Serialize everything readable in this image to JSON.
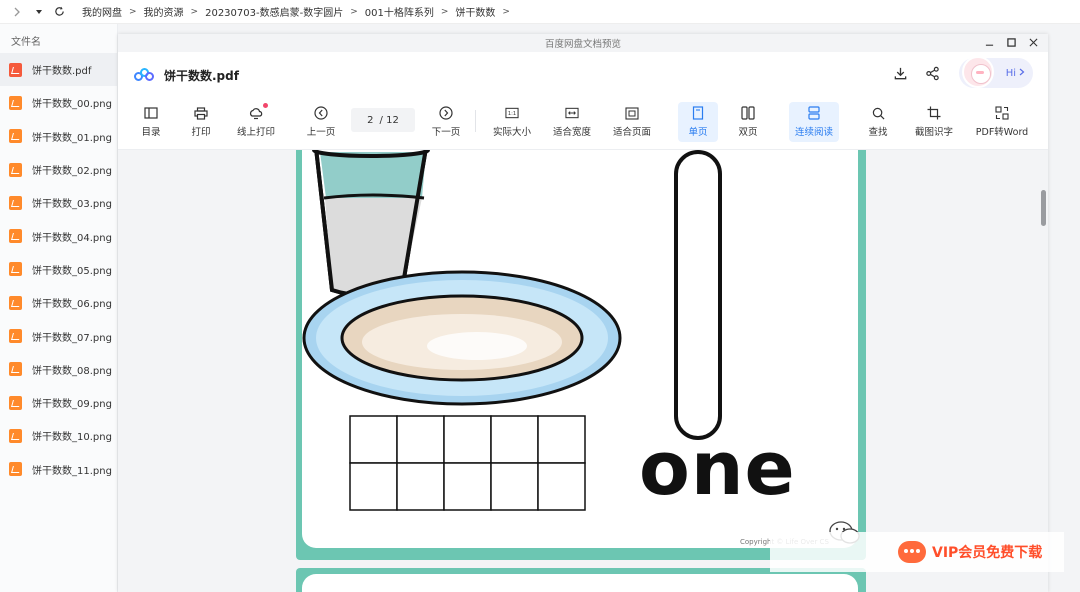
{
  "breadcrumb": [
    "我的网盘",
    "我的资源",
    "20230703-数感启蒙-数字圆片",
    "001十格阵系列",
    "饼干数数"
  ],
  "sidebar": {
    "column_header": "文件名",
    "files": [
      {
        "name": "饼干数数.pdf",
        "type": "pdf"
      },
      {
        "name": "饼干数数_00.png",
        "type": "png"
      },
      {
        "name": "饼干数数_01.png",
        "type": "png"
      },
      {
        "name": "饼干数数_02.png",
        "type": "png"
      },
      {
        "name": "饼干数数_03.png",
        "type": "png"
      },
      {
        "name": "饼干数数_04.png",
        "type": "png"
      },
      {
        "name": "饼干数数_05.png",
        "type": "png"
      },
      {
        "name": "饼干数数_06.png",
        "type": "png"
      },
      {
        "name": "饼干数数_07.png",
        "type": "png"
      },
      {
        "name": "饼干数数_08.png",
        "type": "png"
      },
      {
        "name": "饼干数数_09.png",
        "type": "png"
      },
      {
        "name": "饼干数数_10.png",
        "type": "png"
      },
      {
        "name": "饼干数数_11.png",
        "type": "png"
      }
    ]
  },
  "viewer": {
    "window_title": "百度网盘文档预览",
    "doc_title": "饼干数数.pdf",
    "hi_label": "Hi",
    "toolbar": {
      "toc": "目录",
      "print": "打印",
      "online_print": "线上打印",
      "prev": "上一页",
      "page_current": "2",
      "page_total": "/ 12",
      "next": "下一页",
      "actual_size": "实际大小",
      "fit_width": "适合宽度",
      "fit_page": "适合页面",
      "single_page": "单页",
      "double_page": "双页",
      "continuous": "连续阅读",
      "find": "查找",
      "ocr": "截图识字",
      "pdf_to_word": "PDF转Word"
    }
  },
  "document": {
    "number_word": "one",
    "copyright": "Copyright © Life Over CS"
  },
  "vip_banner": "VIP会员免费下载",
  "colors": {
    "accent": "#2a7df0",
    "frame": "#6cc6b2",
    "vip": "#ff4e2a"
  }
}
